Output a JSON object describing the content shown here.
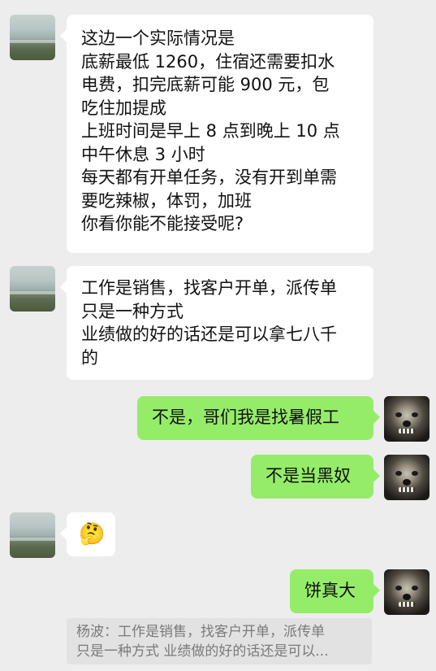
{
  "messages": [
    {
      "sender": "other",
      "lines": [
        "这边一个实际情况是",
        "底薪最低 1260，住宿还需要扣水",
        "电费，扣完底薪可能 900 元，包",
        "吃住加提成",
        "上班时间是早上 8 点到晚上 10 点",
        "中午休息 3 小时",
        "每天都有开单任务，没有开到单需",
        "要吃辣椒，体罚，加班",
        "你看你能不能接受呢?"
      ]
    },
    {
      "sender": "other",
      "lines": [
        "工作是销售，找客户开单，派传单",
        "只是一种方式",
        "业绩做的好的话还是可以拿七八千",
        "的"
      ]
    },
    {
      "sender": "me",
      "text": "不是，哥们我是找暑假工"
    },
    {
      "sender": "me",
      "text": "不是当黑奴"
    },
    {
      "sender": "other",
      "emoji": "🤔"
    },
    {
      "sender": "me",
      "text": "饼真大"
    }
  ],
  "quote": {
    "line1": "杨波：工作是销售，找客户开单，派传单",
    "line2": "只是一种方式 业绩做的好的话还是可以..."
  },
  "colors": {
    "background": "#ededed",
    "my_bubble": "#95ec69",
    "other_bubble": "#ffffff"
  }
}
